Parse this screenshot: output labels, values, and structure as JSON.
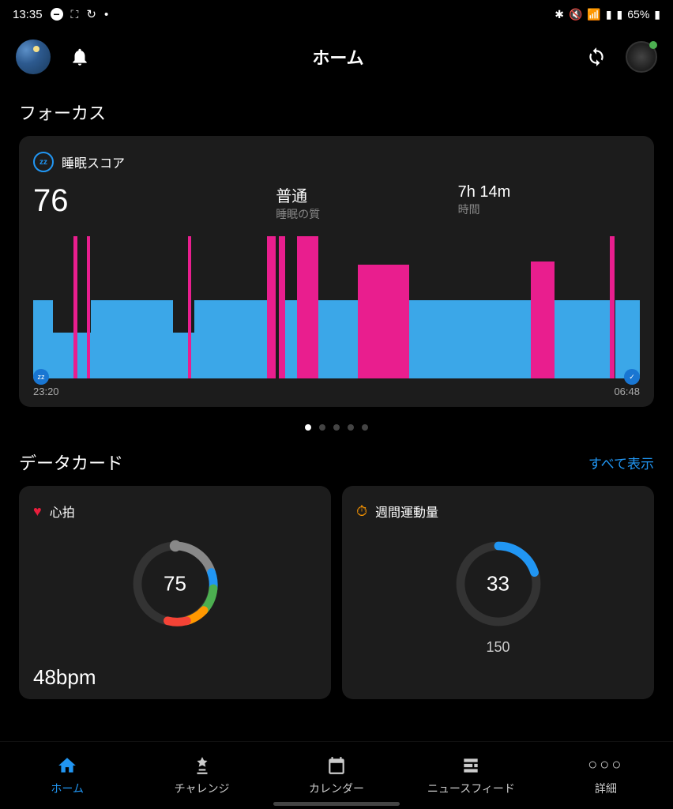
{
  "status_bar": {
    "time": "13:35",
    "battery": "65%"
  },
  "header": {
    "title": "ホーム"
  },
  "focus": {
    "section_title": "フォーカス",
    "card_title": "睡眠スコア",
    "score": "76",
    "quality_value": "普通",
    "quality_label": "睡眠の質",
    "duration_value": "7h 14m",
    "duration_label": "時間",
    "start_time": "23:20",
    "end_time": "06:48",
    "page_dots": {
      "count": 5,
      "active": 0
    }
  },
  "data_cards": {
    "section_title": "データカード",
    "show_all": "すべて表示",
    "heart": {
      "title": "心拍",
      "gauge_value": "75",
      "current": "48bpm"
    },
    "activity": {
      "title": "週間運動量",
      "gauge_value": "33",
      "target": "150"
    }
  },
  "nav": {
    "home": "ホーム",
    "challenge": "チャレンジ",
    "calendar": "カレンダー",
    "newsfeed": "ニュースフィード",
    "more": "詳細"
  },
  "chart_data": {
    "type": "bar",
    "title": "睡眠スコア",
    "x_range": [
      "23:20",
      "06:48"
    ],
    "segments": [
      {
        "start_pct": 0,
        "width_pct": 3.2,
        "height_pct": 55,
        "stage": "light"
      },
      {
        "start_pct": 3.2,
        "width_pct": 6.3,
        "height_pct": 32,
        "stage": "light"
      },
      {
        "start_pct": 6.7,
        "width_pct": 0.6,
        "height_pct": 100,
        "stage": "rem"
      },
      {
        "start_pct": 8.8,
        "width_pct": 0.6,
        "height_pct": 100,
        "stage": "rem"
      },
      {
        "start_pct": 9.5,
        "width_pct": 13.5,
        "height_pct": 55,
        "stage": "light"
      },
      {
        "start_pct": 23,
        "width_pct": 3.5,
        "height_pct": 32,
        "stage": "light"
      },
      {
        "start_pct": 25.5,
        "width_pct": 0.6,
        "height_pct": 100,
        "stage": "rem"
      },
      {
        "start_pct": 26.5,
        "width_pct": 12,
        "height_pct": 55,
        "stage": "light"
      },
      {
        "start_pct": 38.5,
        "width_pct": 1.5,
        "height_pct": 100,
        "stage": "rem"
      },
      {
        "start_pct": 40.5,
        "width_pct": 1,
        "height_pct": 100,
        "stage": "rem"
      },
      {
        "start_pct": 41.5,
        "width_pct": 2,
        "height_pct": 55,
        "stage": "light"
      },
      {
        "start_pct": 43.5,
        "width_pct": 1,
        "height_pct": 100,
        "stage": "rem"
      },
      {
        "start_pct": 44.5,
        "width_pct": 2.5,
        "height_pct": 100,
        "stage": "rem"
      },
      {
        "start_pct": 47,
        "width_pct": 6.5,
        "height_pct": 55,
        "stage": "light"
      },
      {
        "start_pct": 53.5,
        "width_pct": 8.5,
        "height_pct": 80,
        "stage": "deep"
      },
      {
        "start_pct": 62,
        "width_pct": 20,
        "height_pct": 55,
        "stage": "light"
      },
      {
        "start_pct": 82,
        "width_pct": 4,
        "height_pct": 82,
        "stage": "deep"
      },
      {
        "start_pct": 86,
        "width_pct": 9,
        "height_pct": 55,
        "stage": "light"
      },
      {
        "start_pct": 95,
        "width_pct": 0.8,
        "height_pct": 100,
        "stage": "rem"
      },
      {
        "start_pct": 96,
        "width_pct": 4,
        "height_pct": 55,
        "stage": "light"
      }
    ],
    "stage_colors": {
      "light": "#3ba7e8",
      "deep": "#e91e8e",
      "rem": "#e91e8e"
    }
  }
}
